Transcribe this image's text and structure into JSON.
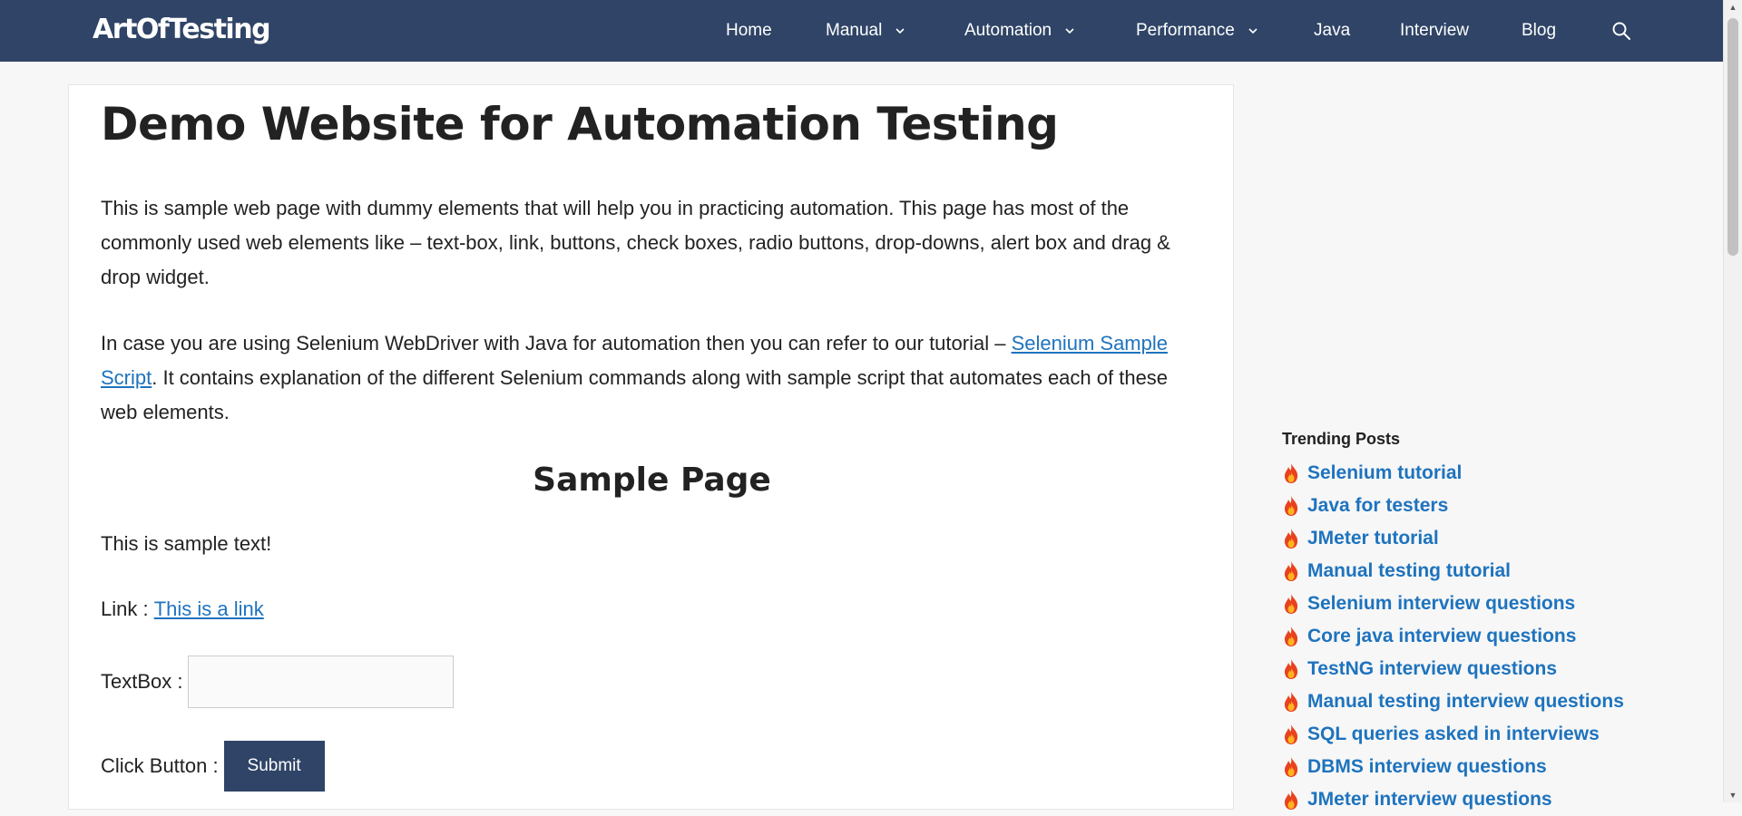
{
  "header": {
    "logo_text": "ArtOfTesting",
    "nav": [
      {
        "label": "Home",
        "has_dropdown": false
      },
      {
        "label": "Manual",
        "has_dropdown": true
      },
      {
        "label": "Automation",
        "has_dropdown": true
      },
      {
        "label": "Performance",
        "has_dropdown": true
      },
      {
        "label": "Java",
        "has_dropdown": false
      },
      {
        "label": "Interview",
        "has_dropdown": false
      },
      {
        "label": "Blog",
        "has_dropdown": false
      }
    ],
    "search_icon": "search-icon"
  },
  "main": {
    "title": "Demo Website for Automation Testing",
    "intro": "This is sample web page with dummy elements that will help you in practicing automation. This page has most of the commonly used web elements like – text-box, link, buttons, check boxes, radio buttons, drop-downs, alert box and drag & drop widget.",
    "para2_before": "In case you are using Selenium WebDriver with Java for automation then you can refer to our tutorial – ",
    "para2_link": "Selenium Sample Script",
    "para2_after": ". It contains explanation of the different Selenium commands along with sample script that automates each of these web elements.",
    "section_title": "Sample Page",
    "sample_text": "This is sample text!",
    "link_label": "Link : ",
    "link_text": "This is a link",
    "textbox_label": "TextBox : ",
    "textbox_value": "",
    "button_label": "Click Button : ",
    "submit_label": "Submit"
  },
  "sidebar": {
    "trending_title": "Trending Posts",
    "items": [
      "Selenium tutorial",
      "Java for testers",
      "JMeter tutorial",
      "Manual testing tutorial",
      "Selenium interview questions",
      "Core java interview questions",
      "TestNG interview questions",
      "Manual testing interview questions",
      "SQL queries asked in interviews",
      "DBMS interview questions",
      "JMeter interview questions"
    ],
    "item_icon": "fire-icon"
  },
  "colors": {
    "nav_bg": "#2f4466",
    "link": "#1e73be",
    "button_bg": "#2f4466",
    "page_bg": "#f7f7f7"
  }
}
